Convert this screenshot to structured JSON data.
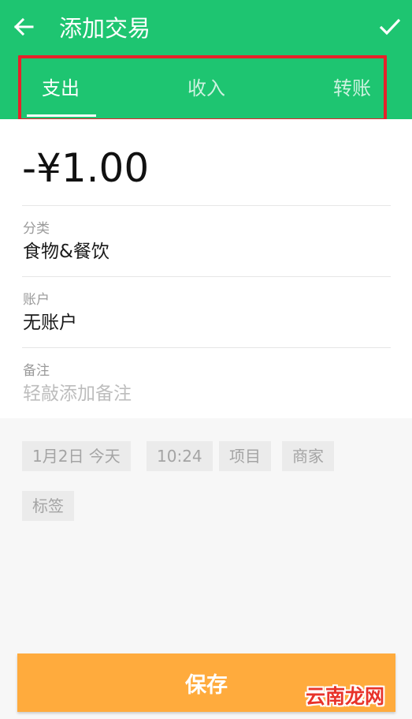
{
  "header": {
    "title": "添加交易",
    "back_icon": "arrow-left-icon",
    "confirm_icon": "check-icon",
    "background_color": "#1ec571"
  },
  "tabs": [
    {
      "label": "支出",
      "selected": true
    },
    {
      "label": "收入",
      "selected": false
    },
    {
      "label": "转账",
      "selected": false
    }
  ],
  "form": {
    "amount": "-¥1.00",
    "category": {
      "label": "分类",
      "value": "食物&餐饮"
    },
    "account": {
      "label": "账户",
      "value": "无账户"
    },
    "note": {
      "label": "备注",
      "placeholder": "轻敲添加备注"
    }
  },
  "chips": {
    "date": "1月2日  今天",
    "time": "10:24",
    "project": "项目",
    "merchant": "商家",
    "tag": "标签"
  },
  "save_label": "保存",
  "save_color": "#ffab3d",
  "watermark": "云南龙网",
  "highlight_color": "#e8212a"
}
